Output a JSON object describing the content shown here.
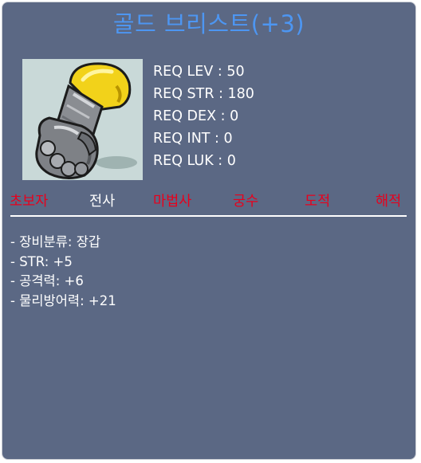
{
  "item": {
    "title": "골드 브리스트(+3)",
    "image_icon": "gold-gauntlet-glove-icon"
  },
  "requirements": [
    {
      "text": "REQ LEV : 50"
    },
    {
      "text": "REQ STR : 180"
    },
    {
      "text": "REQ DEX : 0"
    },
    {
      "text": "REQ INT : 0"
    },
    {
      "text": "REQ LUK : 0"
    }
  ],
  "jobs": [
    {
      "label": "초보자",
      "color": "#e8001c"
    },
    {
      "label": "전사",
      "color": "#ffffff"
    },
    {
      "label": "마법사",
      "color": "#e8001c"
    },
    {
      "label": "궁수",
      "color": "#e8001c"
    },
    {
      "label": "도적",
      "color": "#e8001c"
    },
    {
      "label": "해적",
      "color": "#e8001c"
    }
  ],
  "stats": [
    {
      "text": "- 장비분류: 장갑"
    },
    {
      "text": "- STR: +5"
    },
    {
      "text": "- 공격력: +6"
    },
    {
      "text": "- 물리방어력: +21"
    }
  ],
  "colors": {
    "background": "#5b6884",
    "title": "#4d96f2",
    "image_bg": "#c9d9d8",
    "available_job": "#ffffff",
    "unavailable_job": "#e8001c"
  }
}
